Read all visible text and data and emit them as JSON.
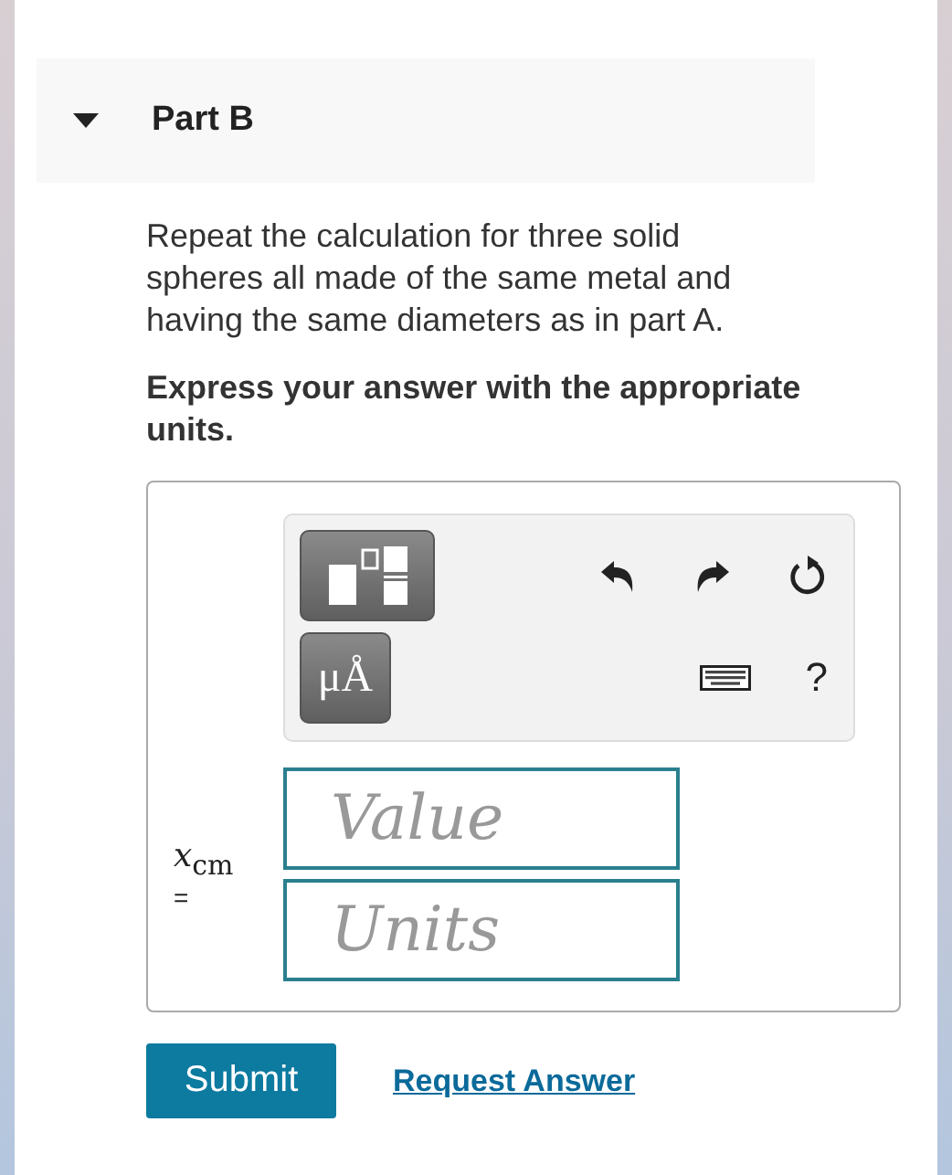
{
  "part": {
    "title": "Part B",
    "expanded": true
  },
  "question": "Repeat the calculation for three solid spheres all made of the same metal and having the same diameters as in part A.",
  "instruction": "Express your answer with the appropriate units.",
  "answer": {
    "label": "*x*$_{cm}$",
    "equals": "=",
    "toolbar": {
      "units_button": "μÅ",
      "help": "?"
    },
    "fields": [
      {
        "placeholder": "Value"
      },
      {
        "placeholder": "Units"
      }
    ]
  },
  "buttons": {
    "submit": "Submit",
    "request": "Request Answer"
  }
}
